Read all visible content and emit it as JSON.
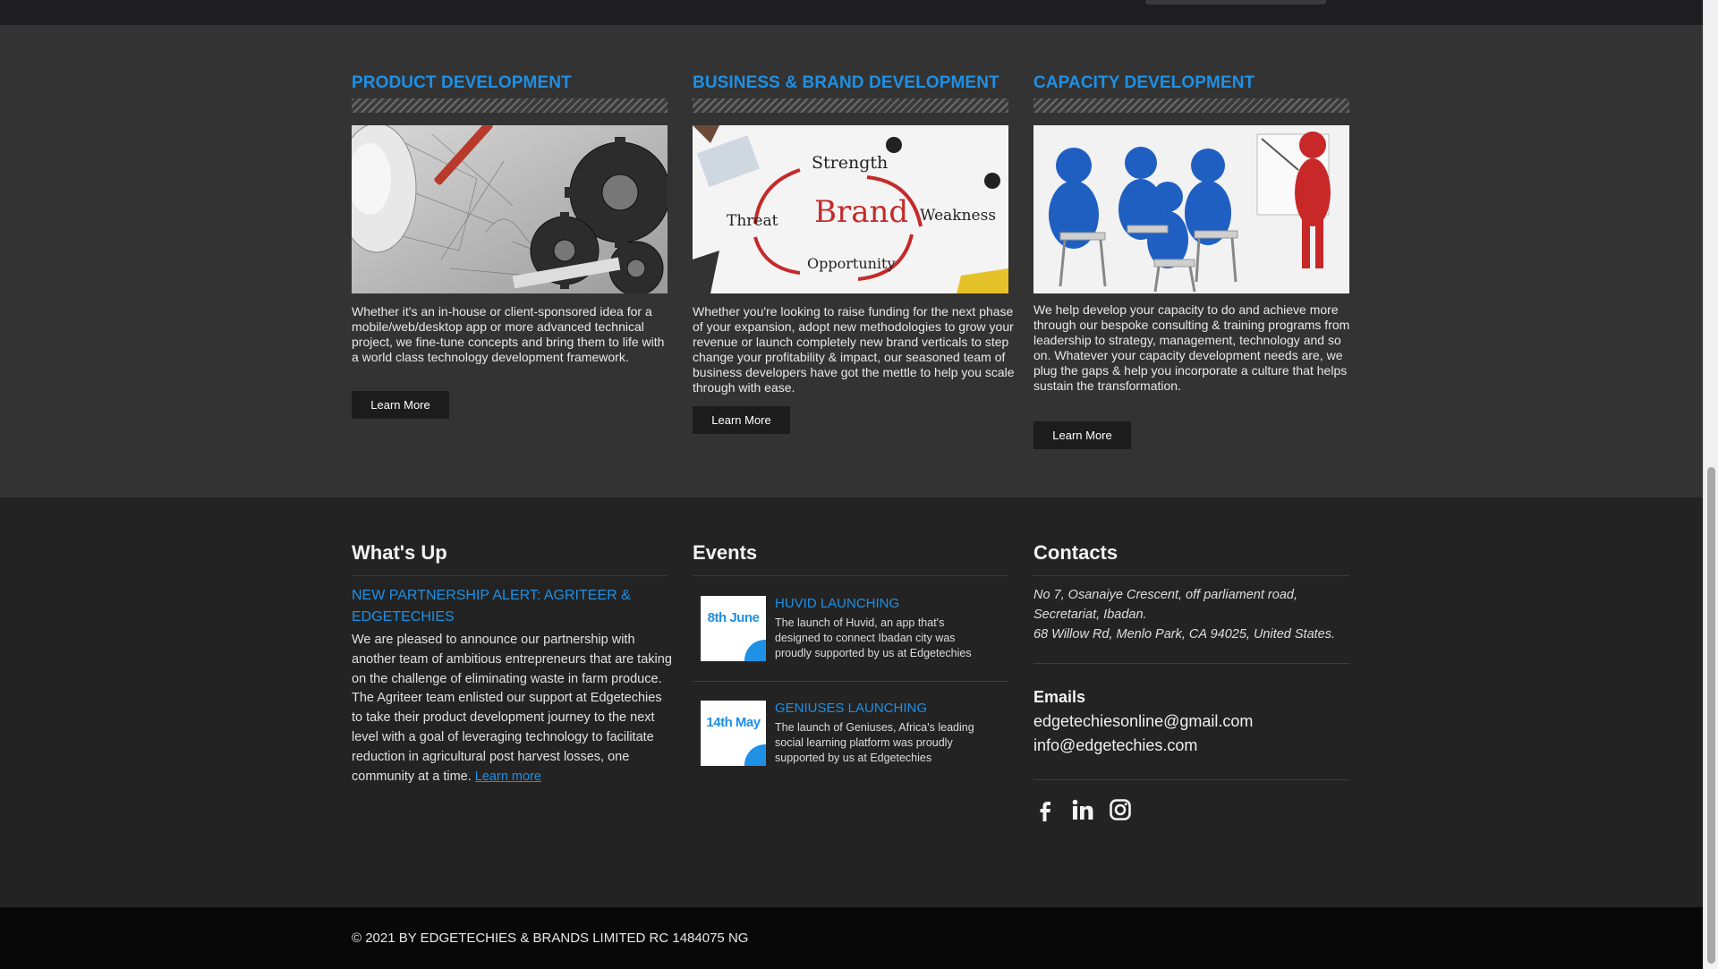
{
  "services": [
    {
      "title": "PRODUCT DEVELOPMENT",
      "text": "Whether it's an in-house or client-sponsored idea for a mobile/web/desktop app or more advanced technical project, we fine-tune concepts and bring them to life with a world class technology development framework.",
      "button": "Learn More"
    },
    {
      "title": "BUSINESS & BRAND DEVELOPMENT",
      "text": "Whether you're looking to raise funding for the next phase of your expansion, adopt new methodologies to grow your revenue or launch completely new brand verticals to step change your profitability & impact, our seasoned team of business developers have got the mettle to help you scale through with ease.",
      "button": "Learn More",
      "image_words": [
        "Strength",
        "Brand",
        "Weakness",
        "Threat",
        "Opportunity"
      ]
    },
    {
      "title": "CAPACITY DEVELOPMENT",
      "text": "We help develop your capacity to do and achieve more through our bespoke consulting & training programs from leadership to strategy, management, technology and so on. Whatever your capacity development needs are, we plug the gaps & help you incorporate a culture that helps sustain the transformation.",
      "button": "Learn More"
    }
  ],
  "whats_up": {
    "heading": "What's Up",
    "title": "NEW PARTNERSHIP ALERT: AGRITEER & EDGETECHIES",
    "body": "We are pleased to announce our partnership with another team of ambitious entrepreneurs that are taking on the challenge of eliminating waste in farm produce. The Agriteer team enlisted our support at Edgetechies to take their product development journey to the next level with a goal of leveraging technology to facilitate reduction in agricultural post harvest losses, one community at a time.",
    "link": "Learn more"
  },
  "events": {
    "heading": "Events",
    "items": [
      {
        "date": "8th June",
        "title": "HUVID LAUNCHING",
        "body": "The launch of Huvid, an app that's designed to connect Ibadan city was proudly supported by us at Edgetechies"
      },
      {
        "date": "14th May",
        "title": "GENIUSES LAUNCHING",
        "body": "The launch of Geniuses, Africa's leading social learning platform was proudly supported by us at Edgetechies"
      }
    ]
  },
  "contacts": {
    "heading": "Contacts",
    "address_1": "No 7, Osanaiye Crescent, off parliament road, Secretariat, Ibadan.",
    "address_2": "68 Willow Rd, Menlo Park, CA 94025, United States.",
    "emails_heading": "Emails",
    "emails": [
      "edgetechiesonline@gmail.com",
      "info@edgetechies.com"
    ],
    "social_icons": [
      "facebook-icon",
      "linkedin-icon",
      "instagram-icon"
    ]
  },
  "copyright": "© 2021 BY EDGETECHIES & BRANDS LIMITED RC 1484075 NG",
  "colors": {
    "accent": "#1e90e6",
    "section_bg": "#333333",
    "footer_bg": "#232323",
    "bottom_bar": "#080808"
  }
}
